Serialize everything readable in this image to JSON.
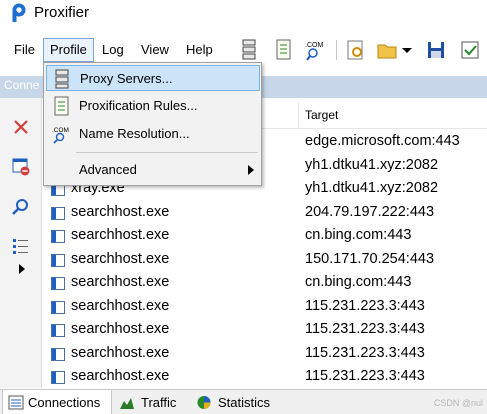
{
  "window": {
    "title": "Proxifier"
  },
  "menubar": {
    "items": [
      {
        "label": "File"
      },
      {
        "label": "Profile"
      },
      {
        "label": "Log"
      },
      {
        "label": "View"
      },
      {
        "label": "Help"
      }
    ],
    "toolbar_icons": [
      "proxy-servers-icon",
      "rules-icon",
      "name-resolution-icon",
      "settings-icon",
      "open-folder-icon",
      "dropdown-arrow-icon",
      "save-icon",
      "checkbox-icon"
    ]
  },
  "connections_strip": {
    "label": "Conne"
  },
  "dropdown": {
    "items": [
      {
        "label": "Proxy Servers...",
        "icon": "proxy-servers-icon",
        "highlighted": true
      },
      {
        "label": "Proxification Rules...",
        "icon": "rules-icon"
      },
      {
        "label": "Name Resolution...",
        "icon": "name-resolution-icon"
      },
      {
        "label": "Advanced",
        "has_submenu": true
      }
    ]
  },
  "table": {
    "columns": [
      {
        "label": "Target"
      }
    ],
    "rows": [
      {
        "app": "",
        "target": "edge.microsoft.com:443"
      },
      {
        "app": "",
        "target": "yh1.dtku41.xyz:2082"
      },
      {
        "app": "xray.exe",
        "target": "yh1.dtku41.xyz:2082"
      },
      {
        "app": "searchhost.exe",
        "target": "204.79.197.222:443"
      },
      {
        "app": "searchhost.exe",
        "target": "cn.bing.com:443"
      },
      {
        "app": "searchhost.exe",
        "target": "150.171.70.254:443"
      },
      {
        "app": "searchhost.exe",
        "target": "cn.bing.com:443"
      },
      {
        "app": "searchhost.exe",
        "target": "115.231.223.3:443"
      },
      {
        "app": "searchhost.exe",
        "target": "115.231.223.3:443"
      },
      {
        "app": "searchhost.exe",
        "target": "115.231.223.3:443"
      },
      {
        "app": "searchhost.exe",
        "target": "115.231.223.3:443"
      }
    ]
  },
  "bottom_tabs": [
    {
      "label": "Connections",
      "icon": "connections-icon",
      "active": true
    },
    {
      "label": "Traffic",
      "icon": "traffic-chart-icon"
    },
    {
      "label": "Statistics",
      "icon": "statistics-pie-icon"
    }
  ],
  "watermark": "CSDN @nul",
  "colors": {
    "menu_highlight": "#cce4f7",
    "strip": "#c7d6e8",
    "accent": "#1f5fbf"
  }
}
